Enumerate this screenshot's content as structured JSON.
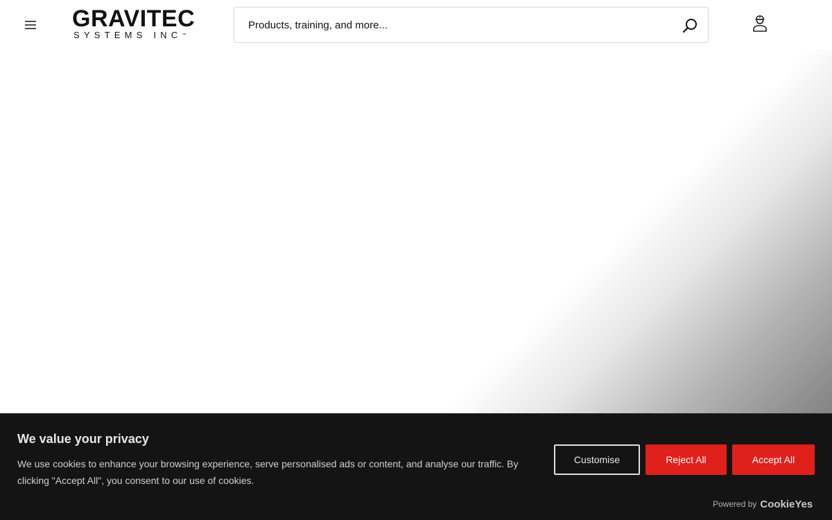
{
  "header": {
    "logo_title": "GRAVITEC",
    "logo_subtitle": "SYSTEMS INC",
    "logo_trademark": "™",
    "menu_icon": "hamburger-menu-icon",
    "search": {
      "placeholder": "Products, training, and more...",
      "value": "",
      "icon": "search-icon"
    },
    "account_icon": "user-account-icon"
  },
  "cookie_banner": {
    "title": "We value your privacy",
    "text": "We use cookies to enhance your browsing experience, serve personalised ads or content, and analyse our traffic. By clicking \"Accept All\", you consent to our use of cookies.",
    "customise_label": "Customise",
    "reject_label": "Reject All",
    "accept_label": "Accept All",
    "powered_by": "Powered by",
    "powered_brand": "CookieYes"
  },
  "colors": {
    "accent_red": "#e0201b",
    "banner_bg": "#141414",
    "text_dark": "#111111"
  }
}
